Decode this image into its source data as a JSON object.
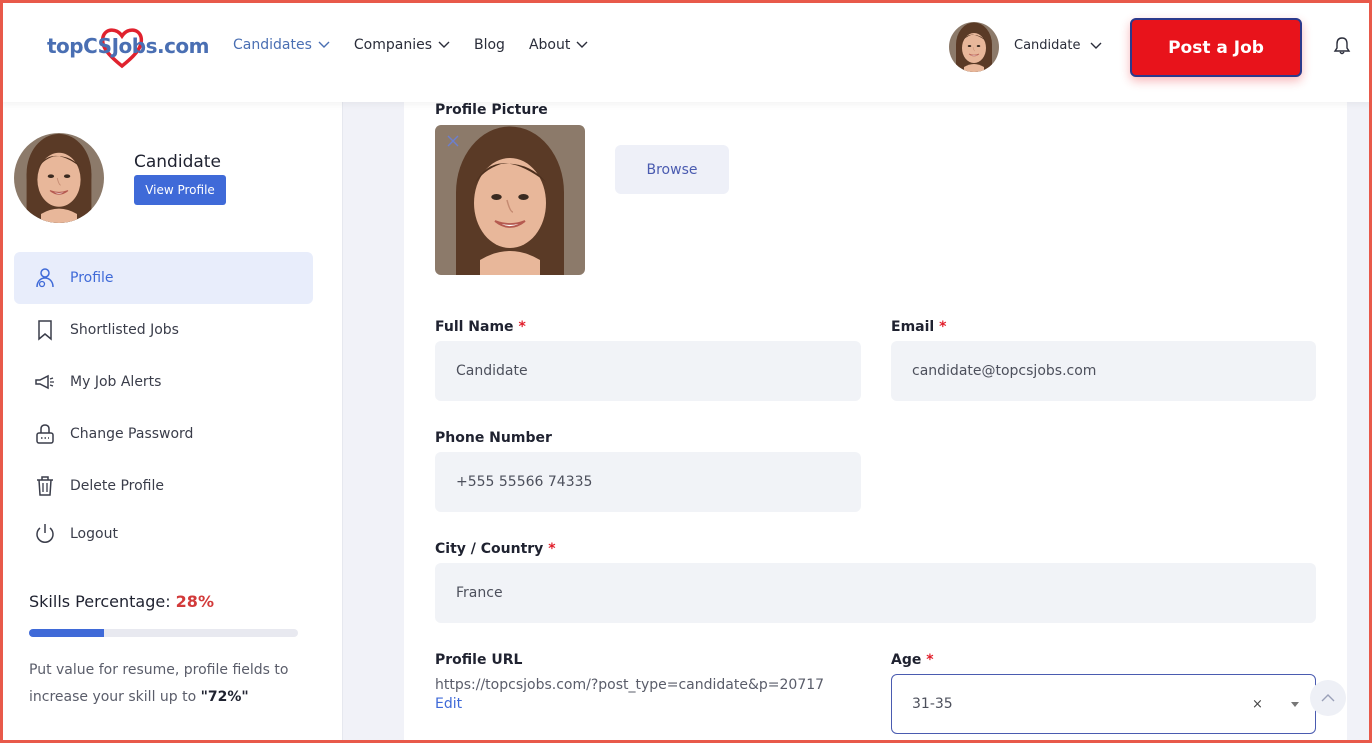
{
  "header": {
    "logo_text": "topCSJobs.com",
    "nav": [
      {
        "label": "Candidates",
        "has_dropdown": true,
        "active": true
      },
      {
        "label": "Companies",
        "has_dropdown": true,
        "active": false
      },
      {
        "label": "Blog",
        "has_dropdown": false,
        "active": false
      },
      {
        "label": "About",
        "has_dropdown": true,
        "active": false
      }
    ],
    "user_label": "Candidate",
    "post_job_label": "Post a Job"
  },
  "sidebar": {
    "name": "Candidate",
    "view_profile_label": "View Profile",
    "menu": [
      {
        "label": "Profile",
        "icon": "user-icon",
        "active": true
      },
      {
        "label": "Shortlisted Jobs",
        "icon": "bookmark-icon",
        "active": false
      },
      {
        "label": "My Job Alerts",
        "icon": "megaphone-icon",
        "active": false
      },
      {
        "label": "Change Password",
        "icon": "lock-icon",
        "active": false
      },
      {
        "label": "Delete Profile",
        "icon": "trash-icon",
        "active": false
      },
      {
        "label": "Logout",
        "icon": "power-icon",
        "active": false
      }
    ],
    "skills": {
      "title": "Skills Percentage:",
      "percent_label": "28%",
      "percent": 28,
      "note_prefix": "Put value for resume, profile fields to increase your skill up to ",
      "note_target": "\"72%\""
    }
  },
  "form": {
    "profile_picture_label": "Profile Picture",
    "browse_label": "Browse",
    "full_name": {
      "label": "Full Name",
      "required_mark": "*",
      "value": "Candidate"
    },
    "email": {
      "label": "Email",
      "required_mark": "*",
      "value": "candidate@topcsjobs.com"
    },
    "phone": {
      "label": "Phone Number",
      "value": "+555 55566 74335"
    },
    "city": {
      "label": "City / Country",
      "required_mark": "*",
      "value": "France"
    },
    "profile_url": {
      "label": "Profile URL",
      "value": "https://topcsjobs.com/?post_type=candidate&p=20717",
      "edit_label": "Edit"
    },
    "age": {
      "label": "Age",
      "required_mark": "*",
      "value": "31-35",
      "clear_label": "×"
    }
  },
  "colors": {
    "accent": "#3f6ad8",
    "post_job_bg": "#e8131b",
    "required": "#e11d2a",
    "skills_percent": "#d23a3a"
  }
}
